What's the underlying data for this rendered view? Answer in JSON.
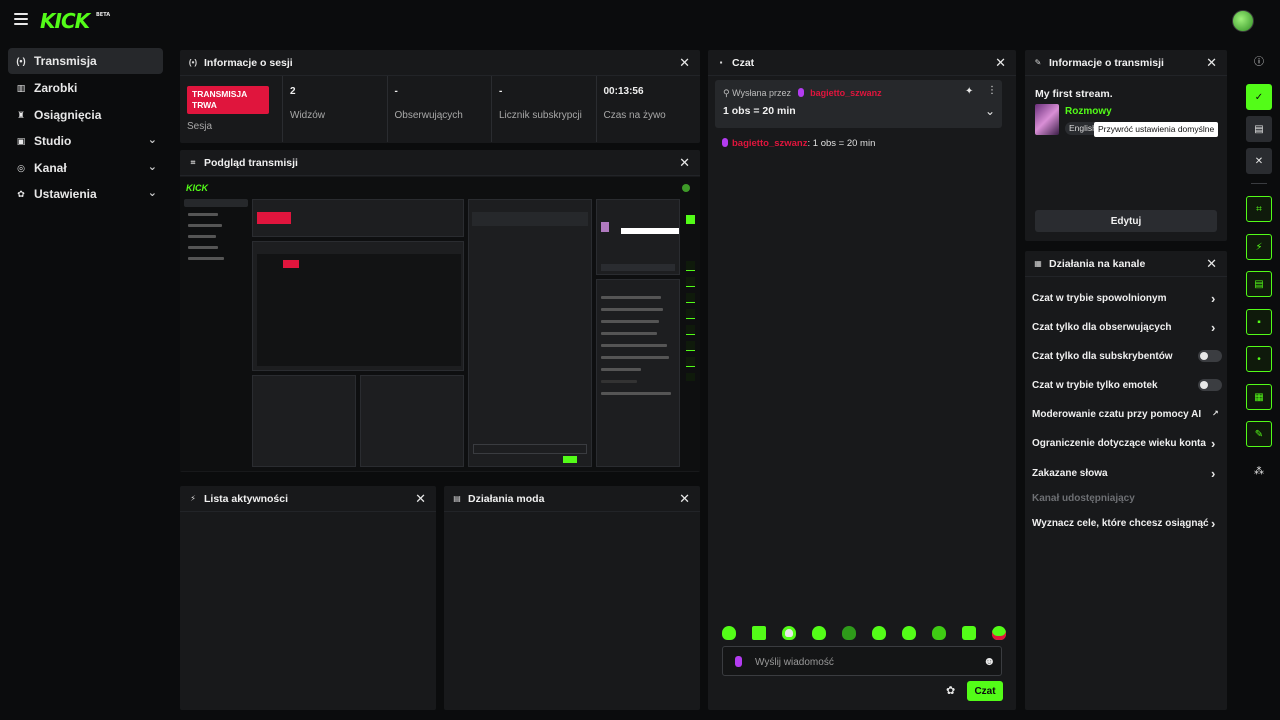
{
  "brand": {
    "logo": "KICK",
    "badge": "BETA",
    "accent": "#53fc18",
    "live_color": "#e0153d"
  },
  "sidebar": {
    "items": [
      {
        "icon": "broadcast-icon",
        "label": "Transmisja",
        "active": true
      },
      {
        "icon": "earnings-icon",
        "label": "Zarobki"
      },
      {
        "icon": "trophy-icon",
        "label": "Osiągnięcia"
      },
      {
        "icon": "studio-icon",
        "label": "Studio",
        "expandable": true
      },
      {
        "icon": "channel-icon",
        "label": "Kanał",
        "expandable": true
      },
      {
        "icon": "gear-icon",
        "label": "Ustawienia",
        "expandable": true
      }
    ]
  },
  "session": {
    "title": "Informacje o sesji",
    "live_badge": "TRANSMISJA TRWA",
    "session_label": "Sesja",
    "stats": [
      {
        "value": "2",
        "label": "Widzów"
      },
      {
        "value": "-",
        "label": "Obserwujących"
      },
      {
        "value": "-",
        "label": "Licznik subskrypcji"
      },
      {
        "value": "00:13:56",
        "label": "Czas na żywo"
      }
    ]
  },
  "preview": {
    "title": "Podgląd transmisji"
  },
  "activity": {
    "title": "Lista aktywności"
  },
  "modactions": {
    "title": "Działania moda"
  },
  "chat": {
    "title": "Czat",
    "pinned_prefix": "Wysłana przez",
    "pinned_user": "bagietto_szwanz",
    "pinned_message": "1 obs = 20 min",
    "messages": [
      {
        "user": "bagietto_szwanz",
        "text": "1 obs = 20 min"
      }
    ],
    "emote_count": 10,
    "input_placeholder": "Wyślij wiadomość",
    "send_label": "Czat"
  },
  "stream_info": {
    "title": "Informacje o transmisji",
    "stream_title": "My first stream.",
    "category": "Rozmowy",
    "language_tag": "English",
    "tooltip": "Przywróć ustawienia domyślne",
    "edit_label": "Edytuj"
  },
  "channel_actions": {
    "title": "Działania na kanale",
    "items": [
      {
        "label": "Czat w trybie spowolnionym",
        "control": "arrow"
      },
      {
        "label": "Czat tylko dla obserwujących",
        "control": "arrow"
      },
      {
        "label": "Czat tylko dla subskrybentów",
        "control": "toggle",
        "on": false
      },
      {
        "label": "Czat w trybie tylko emotek",
        "control": "toggle",
        "on": false
      },
      {
        "label": "Moderowanie czatu przy pomocy AI",
        "control": "external"
      },
      {
        "label": "Ograniczenie dotyczące wieku konta",
        "control": "arrow"
      },
      {
        "label": "Zakazane słowa",
        "control": "arrow"
      },
      {
        "label": "Kanał udostępniający",
        "control": "none",
        "disabled": true
      },
      {
        "label": "Wyznacz cele, które chcesz osiągnąć",
        "control": "arrow"
      }
    ]
  },
  "right_rail": [
    "info-icon",
    "check-icon",
    "layout-icon",
    "close-icon",
    "preview-icon",
    "lightning-icon",
    "document-icon",
    "chat-icon",
    "broadcast-icon",
    "panels-icon",
    "wrench-icon",
    "moderators-icon"
  ]
}
